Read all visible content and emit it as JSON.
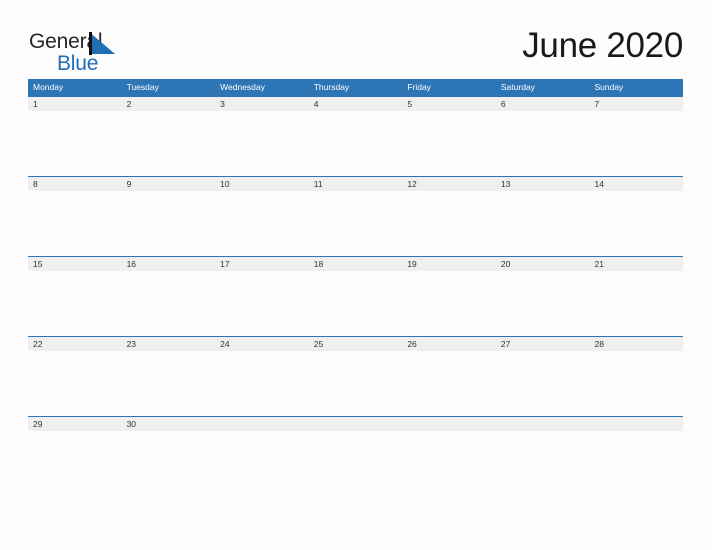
{
  "brand": {
    "name_part1": "General",
    "name_part2": "Blue",
    "triangle_icon": "triangle-icon",
    "color_dark": "#262626",
    "color_blue": "#1f6fb5"
  },
  "header": {
    "title": "June 2020"
  },
  "calendar": {
    "month": "June",
    "year": "2020",
    "header_color": "#2e75b6",
    "date_band_color": "#efefef",
    "weekdays": [
      "Monday",
      "Tuesday",
      "Wednesday",
      "Thursday",
      "Friday",
      "Saturday",
      "Sunday"
    ],
    "weeks": [
      [
        "1",
        "2",
        "3",
        "4",
        "5",
        "6",
        "7"
      ],
      [
        "8",
        "9",
        "10",
        "11",
        "12",
        "13",
        "14"
      ],
      [
        "15",
        "16",
        "17",
        "18",
        "19",
        "20",
        "21"
      ],
      [
        "22",
        "23",
        "24",
        "25",
        "26",
        "27",
        "28"
      ],
      [
        "29",
        "30",
        "",
        "",
        "",
        "",
        ""
      ],
      [
        "",
        "",
        "",
        "",
        "",
        "",
        ""
      ]
    ]
  }
}
